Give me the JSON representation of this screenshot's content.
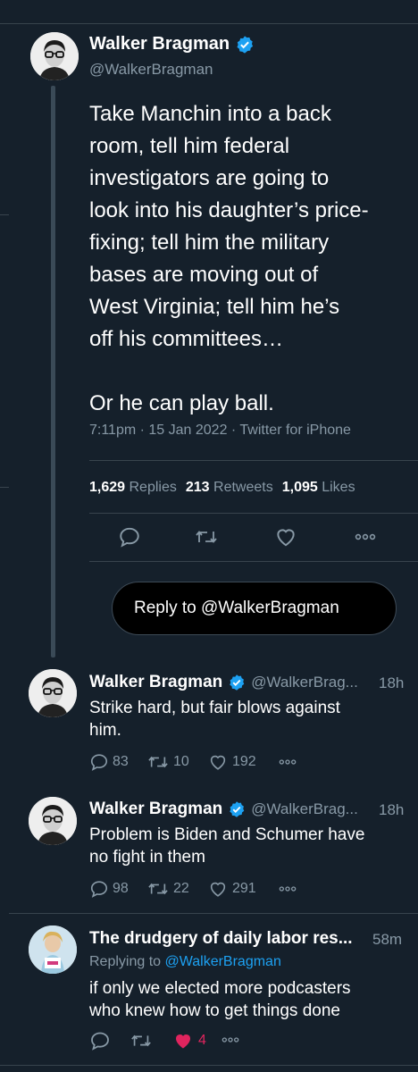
{
  "main_tweet": {
    "name": "Walker Bragman",
    "handle": "@WalkerBragman",
    "text": "Take Manchin into a back\nroom, tell him federal\ninvestigators are going to\nlook into his daughter’s price-\nfixing; tell him the military\nbases are moving out of\nWest Virginia; tell him he’s\noff his committees…\n\nOr he can play ball.",
    "meta": "7:11pm · 15 Jan 2022 · Twitter for iPhone",
    "stats": {
      "replies_count": "1,629",
      "replies_label": "Replies",
      "retweets_count": "213",
      "retweets_label": "Retweets",
      "likes_count": "1,095",
      "likes_label": "Likes"
    }
  },
  "reply_box": {
    "placeholder": "Reply to @WalkerBragman"
  },
  "replies": [
    {
      "name": "Walker Bragman",
      "handle": "@WalkerBrag...",
      "time": "18h",
      "text": "Strike hard, but fair blows against\nhim.",
      "reply_count": "83",
      "retweet_count": "10",
      "like_count": "192"
    },
    {
      "name": "Walker Bragman",
      "handle": "@WalkerBrag...",
      "time": "18h",
      "text": "Problem is Biden and Schumer have\nno fight in them",
      "reply_count": "98",
      "retweet_count": "22",
      "like_count": "291"
    },
    {
      "name": "The drudgery of daily labor res...",
      "time": "58m",
      "replying_prefix": "Replying to ",
      "replying_handle": "@WalkerBragman",
      "text": "if only we elected more podcasters\nwho knew how to get things done",
      "like_count": "4"
    }
  ],
  "icons": {
    "verified": "verified-badge",
    "reply": "speech-bubble",
    "retweet": "retweet-arrows",
    "like": "heart",
    "more": "three-dots"
  },
  "colors": {
    "background": "#15202b",
    "accent": "#1da1f2",
    "muted": "#8899a6",
    "like": "#e0245e"
  }
}
